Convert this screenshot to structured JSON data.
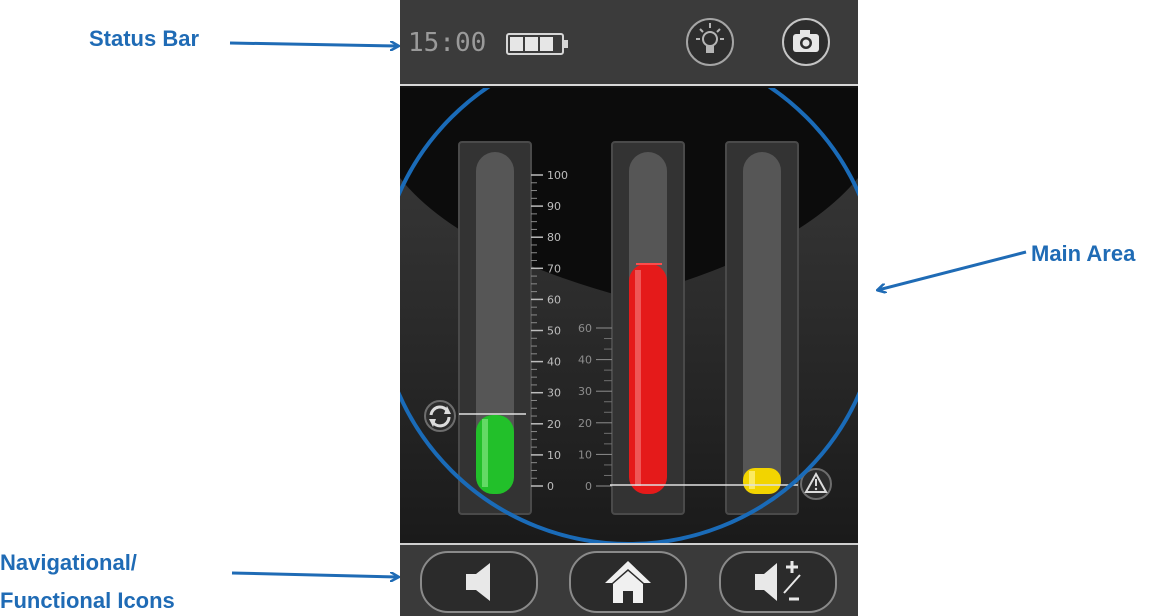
{
  "callouts": {
    "status_bar": "Status Bar",
    "main_area": "Main Area",
    "nav_line1": "Navigational/",
    "nav_line2": "Functional Icons"
  },
  "status_bar": {
    "time": "15:00",
    "battery_icon": "battery-icon",
    "light_icon": "lightbulb-icon",
    "camera_icon": "camera-icon"
  },
  "gauges": [
    {
      "name": "green-gauge",
      "color": "#22c02a",
      "level_percent": 22,
      "scale": [
        "100",
        "90",
        "80",
        "70",
        "60",
        "50",
        "40",
        "30",
        "20",
        "10",
        "0"
      ],
      "indicator_icon": "refresh-icon"
    },
    {
      "name": "red-gauge",
      "color": "#e51a1a",
      "level_percent": 70,
      "scale": [
        "60",
        "40",
        "30",
        "20",
        "10",
        "0"
      ]
    },
    {
      "name": "yellow-gauge",
      "color": "#f2d400",
      "level_percent": 3,
      "indicator_icon": "warning-icon"
    }
  ],
  "nav": {
    "buttons": [
      "speaker-icon",
      "home-icon",
      "volume-adjust-icon"
    ]
  },
  "colors": {
    "callout_blue": "#1f6bb5",
    "circle_blue": "#1a6bb8"
  }
}
